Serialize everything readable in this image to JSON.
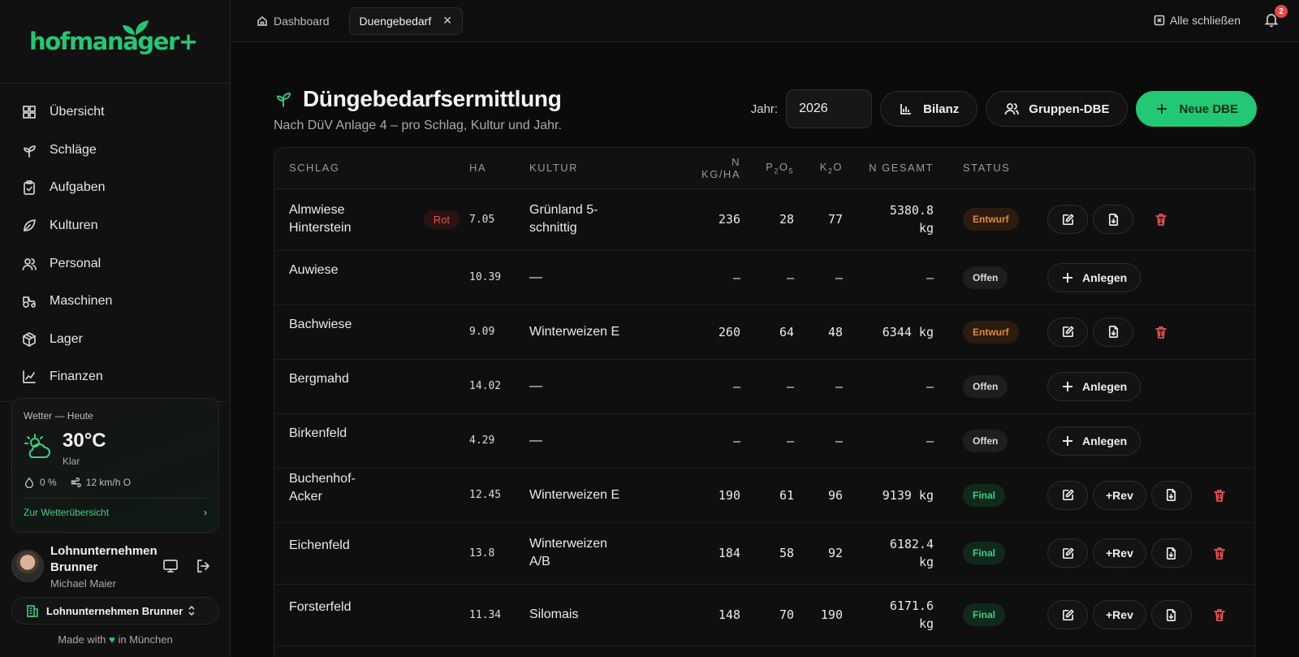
{
  "app": {
    "brand": "hofmanager+"
  },
  "sidebar": {
    "items": [
      {
        "label": "Übersicht",
        "icon": "grid-icon"
      },
      {
        "label": "Schläge",
        "icon": "sprout-icon"
      },
      {
        "label": "Aufgaben",
        "icon": "clipboard-icon"
      },
      {
        "label": "Kulturen",
        "icon": "leaf-icon"
      },
      {
        "label": "Personal",
        "icon": "users-icon"
      },
      {
        "label": "Maschinen",
        "icon": "tractor-icon"
      },
      {
        "label": "Lager",
        "icon": "package-icon"
      },
      {
        "label": "Finanzen",
        "icon": "chart-line-icon"
      }
    ],
    "weather": {
      "heading": "Wetter — Heute",
      "temp": "30°C",
      "condition": "Klar",
      "precip": "0 %",
      "wind": "12 km/h O",
      "link": "Zur Wetterübersicht"
    },
    "user": {
      "company": "Lohnunternehmen Brunner",
      "name": "Michael Maier"
    },
    "org": {
      "name": "Lohnunternehmen Brunner"
    },
    "footer": {
      "prefix": "Made with",
      "heart": "♥",
      "suffix": "in München"
    }
  },
  "topbar": {
    "tabs": [
      {
        "label": "Dashboard"
      },
      {
        "label": "Duengebedarf"
      }
    ],
    "close_all": "Alle schließen",
    "notification_count": "2"
  },
  "page": {
    "title": "Düngebedarfsermittlung",
    "subtitle": "Nach DüV Anlage 4 – pro Schlag, Kultur und Jahr.",
    "year_label": "Jahr:",
    "year_value": "2026",
    "bilanz_label": "Bilanz",
    "gruppen_label": "Gruppen-DBE",
    "new_label": "Neue DBE"
  },
  "table": {
    "headers": {
      "schlag": "SCHLAG",
      "ha": "HA",
      "kultur": "KULTUR",
      "n_top": "N",
      "n_bottom": "KG/HA",
      "p_pre": "P",
      "p_sub1": "2",
      "p_mid": "O",
      "p_sub2": "5",
      "k_pre": "K",
      "k_sub": "2",
      "k_post": "O",
      "n_gesamt": "N GESAMT",
      "status": "STATUS"
    },
    "rows": [
      {
        "schlag": "Almwiese Hinterstein",
        "tag": "Rot",
        "ha": "7.05",
        "kultur": "Grünland 5-schnittig",
        "n": "236",
        "p": "28",
        "k": "77",
        "ng": "5380.8 kg",
        "status": "Entwurf",
        "st": "entwurf",
        "actions": "edit-pdf-del"
      },
      {
        "schlag": "Auwiese",
        "tag": "",
        "ha": "10.39",
        "kultur": "—",
        "n": "–",
        "p": "–",
        "k": "–",
        "ng": "–",
        "status": "Offen",
        "st": "offen",
        "actions": "anlegen"
      },
      {
        "schlag": "Bachwiese",
        "tag": "",
        "ha": "9.09",
        "kultur": "Winterweizen E",
        "n": "260",
        "p": "64",
        "k": "48",
        "ng": "6344 kg",
        "status": "Entwurf",
        "st": "entwurf",
        "actions": "edit-pdf-del"
      },
      {
        "schlag": "Bergmahd",
        "tag": "",
        "ha": "14.02",
        "kultur": "—",
        "n": "–",
        "p": "–",
        "k": "–",
        "ng": "–",
        "status": "Offen",
        "st": "offen",
        "actions": "anlegen"
      },
      {
        "schlag": "Birkenfeld",
        "tag": "",
        "ha": "4.29",
        "kultur": "—",
        "n": "–",
        "p": "–",
        "k": "–",
        "ng": "–",
        "status": "Offen",
        "st": "offen",
        "actions": "anlegen"
      },
      {
        "schlag": "Buchenhof-Acker",
        "tag": "",
        "ha": "12.45",
        "kultur": "Winterweizen E",
        "n": "190",
        "p": "61",
        "k": "96",
        "ng": "9139 kg",
        "status": "Final",
        "st": "final",
        "actions": "edit-rev-pdf-del"
      },
      {
        "schlag": "Eichenfeld",
        "tag": "",
        "ha": "13.8",
        "kultur": "Winterweizen A/B",
        "n": "184",
        "p": "58",
        "k": "92",
        "ng": "6182.4 kg",
        "status": "Final",
        "st": "final",
        "actions": "edit-rev-pdf-del"
      },
      {
        "schlag": "Forsterfeld",
        "tag": "",
        "ha": "11.34",
        "kultur": "Silomais",
        "n": "148",
        "p": "70",
        "k": "190",
        "ng": "6171.6 kg",
        "status": "Final",
        "st": "final",
        "actions": "edit-rev-pdf-del"
      }
    ],
    "anlegen_label": "Anlegen",
    "rev_label": "+Rev"
  }
}
